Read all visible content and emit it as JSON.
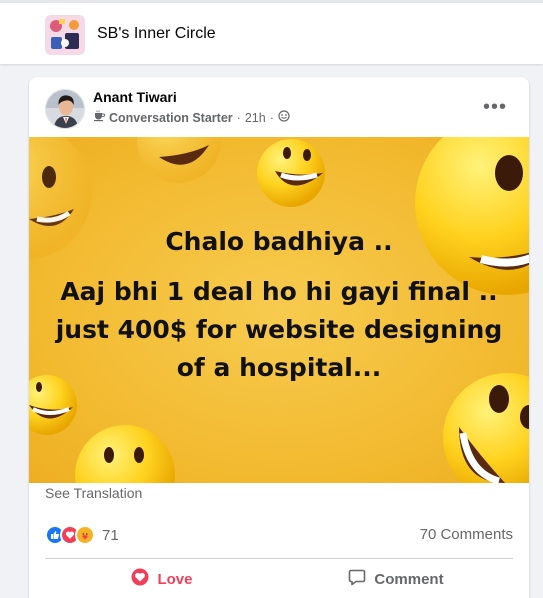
{
  "group": {
    "title": "SB's Inner Circle"
  },
  "post": {
    "author": "Anant Tiwari",
    "role": "Conversation Starter",
    "time": "21h",
    "more_label": "•••",
    "text_line1": "Chalo badhiya ..",
    "text_line2": "Aaj bhi 1 deal ho hi gayi final .. just 400$ for website designing of a hospital...",
    "see_translation": "See Translation",
    "reaction_count": "71",
    "comments_count": "70 Comments",
    "actions": {
      "love": "Love",
      "comment": "Comment"
    }
  },
  "colors": {
    "love": "#f33e58",
    "like": "#1877f2",
    "muted": "#65676b"
  }
}
